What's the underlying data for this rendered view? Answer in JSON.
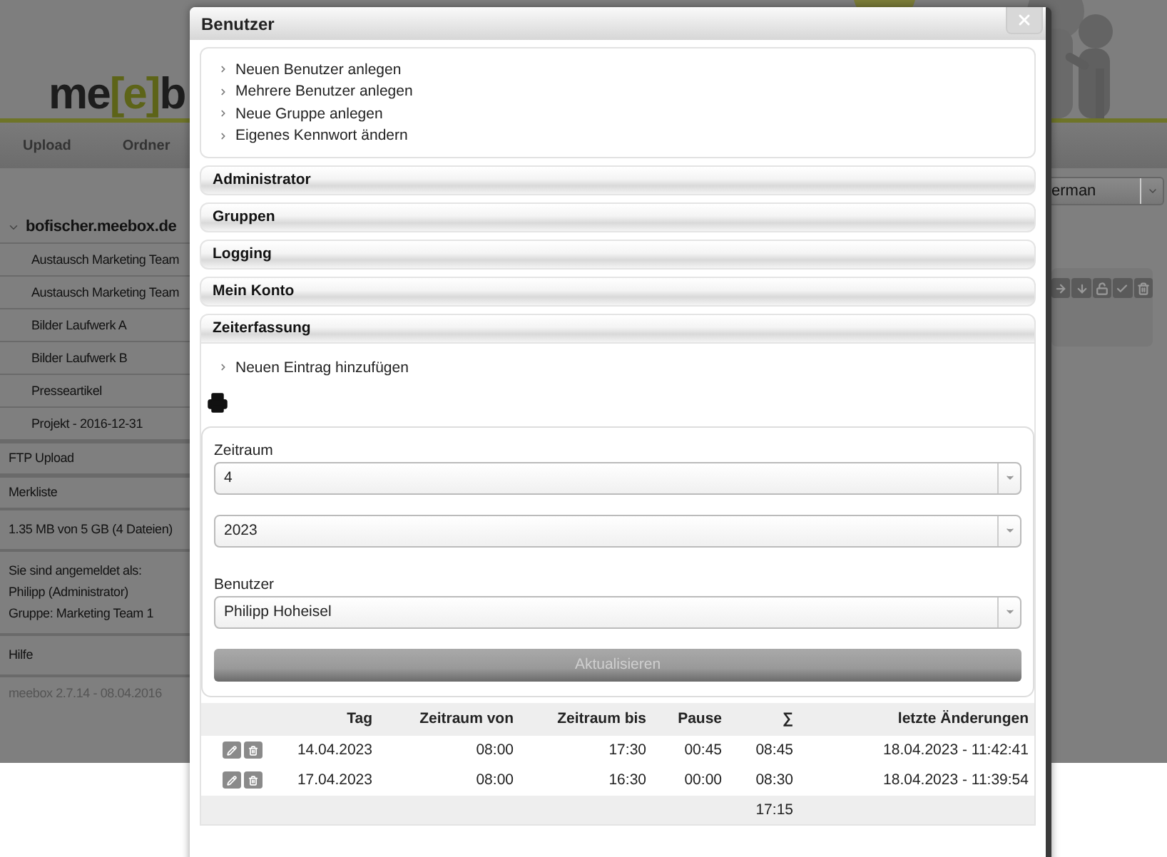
{
  "logo": {
    "parts": [
      "me",
      "[e]",
      "b"
    ]
  },
  "nav": [
    "Upload",
    "Ordner"
  ],
  "language_select": {
    "value": "erman"
  },
  "sidebar": {
    "root": {
      "label": "bofischer.meebox.de",
      "expanded": true,
      "children": [
        "Austausch Marketing Team",
        "Austausch Marketing Team",
        "Bilder Laufwerk A",
        "Bilder Laufwerk B",
        "Presseartikel",
        "Projekt - 2016-12-31"
      ]
    },
    "items": [
      "FTP Upload",
      "Merkliste"
    ],
    "quota": "1.35 MB von 5 GB (4 Dateien)",
    "login": [
      "Sie sind angemeldet als:",
      "Philipp (Administrator)",
      "Gruppe: Marketing Team 1"
    ],
    "help": "Hilfe",
    "version": "meebox 2.7.14 - 08.04.2016"
  },
  "dialog": {
    "title": "Benutzer",
    "links": [
      "Neuen Benutzer anlegen",
      "Mehrere Benutzer anlegen",
      "Neue Gruppe anlegen",
      "Eigenes Kennwort ändern"
    ],
    "sections": [
      {
        "label": "Administrator",
        "expanded": false
      },
      {
        "label": "Gruppen",
        "expanded": false
      },
      {
        "label": "Logging",
        "expanded": false
      },
      {
        "label": "Mein Konto",
        "expanded": false
      },
      {
        "label": "Zeiterfassung",
        "expanded": true
      }
    ],
    "time_tracking": {
      "link": "Neuen Eintrag hinzufügen",
      "fields": [
        {
          "label": "Zeitraum",
          "value": "4"
        },
        {
          "value": "2023"
        },
        {
          "label": "Benutzer",
          "value": "Philipp Hoheisel"
        }
      ],
      "button": {
        "label": "Aktualisieren",
        "disabled": true
      },
      "table": {
        "columns": [
          "Tag",
          "Zeitraum von",
          "Zeitraum bis",
          "Pause",
          "∑",
          "letzte Änderungen"
        ],
        "rows": [
          [
            "14.04.2023",
            "08:00",
            "17:30",
            "00:45",
            "08:45",
            "18.04.2023 - 11:42:41"
          ],
          [
            "17.04.2023",
            "08:00",
            "16:30",
            "00:00",
            "08:30",
            "18.04.2023 - 11:39:54"
          ]
        ],
        "total": "17:15"
      }
    }
  }
}
